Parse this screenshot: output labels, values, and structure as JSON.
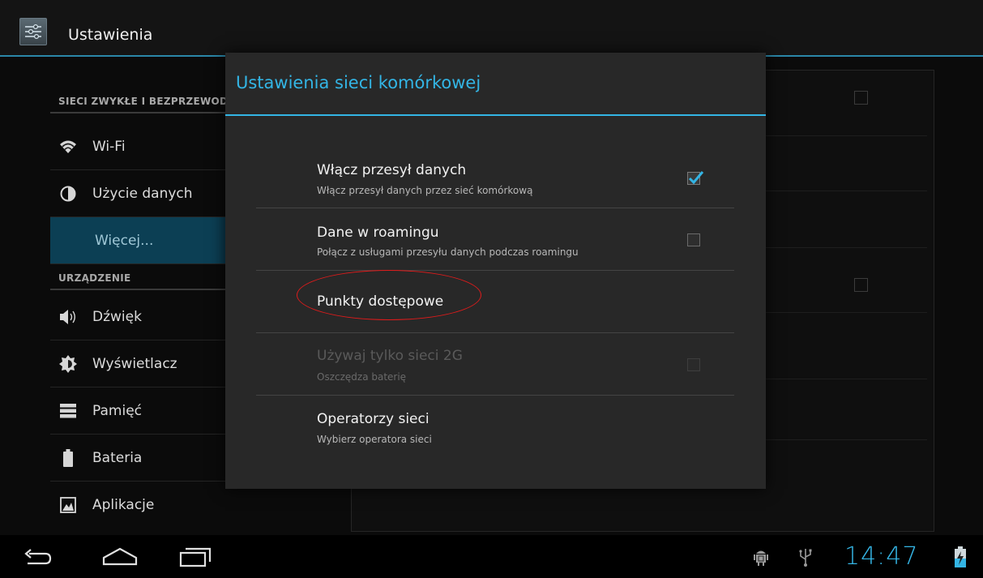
{
  "actionbar": {
    "title": "Ustawienia",
    "icon": "settings-sliders-icon"
  },
  "sidebar": {
    "sections": [
      {
        "header": "SIECI ZWYKŁE I BEZPRZEWODOWE"
      },
      {
        "header": "URZĄDZENIE"
      }
    ],
    "items": [
      {
        "label": "Wi-Fi",
        "icon": "wifi-icon"
      },
      {
        "label": "Użycie danych",
        "icon": "data-usage-icon"
      },
      {
        "label": "Więcej...",
        "icon": "",
        "selected": true
      },
      {
        "label": "Dźwięk",
        "icon": "speaker-icon"
      },
      {
        "label": "Wyświetlacz",
        "icon": "brightness-icon"
      },
      {
        "label": "Pamięć",
        "icon": "storage-icon"
      },
      {
        "label": "Bateria",
        "icon": "battery-icon"
      },
      {
        "label": "Aplikacje",
        "icon": "apps-icon"
      }
    ]
  },
  "dialog": {
    "title": "Ustawienia sieci komórkowej",
    "prefs": [
      {
        "title": "Włącz przesył danych",
        "summary": "Włącz przesył danych przez sieć komórkową",
        "checkbox": true,
        "checked": true,
        "enabled": true
      },
      {
        "title": "Dane w roamingu",
        "summary": "Połącz z usługami przesyłu danych podczas roamingu",
        "checkbox": true,
        "checked": false,
        "enabled": true
      },
      {
        "title": "Punkty dostępowe",
        "summary": "",
        "checkbox": false,
        "enabled": true,
        "annotated": true
      },
      {
        "title": "Używaj tylko sieci 2G",
        "summary": "Oszczędza baterię",
        "checkbox": true,
        "checked": false,
        "enabled": false
      },
      {
        "title": "Operatorzy sieci",
        "summary": "Wybierz operatora sieci",
        "checkbox": false,
        "enabled": true
      }
    ]
  },
  "statusbar": {
    "time": "14:47",
    "icons": [
      "android-debug-icon",
      "usb-icon",
      "battery-charging-icon"
    ]
  },
  "navbar": {
    "buttons": [
      "back-icon",
      "home-icon",
      "recent-apps-icon"
    ]
  },
  "colors": {
    "accent": "#33b5e5",
    "selected": "#0c3f54",
    "annotation": "#e01b1b"
  }
}
